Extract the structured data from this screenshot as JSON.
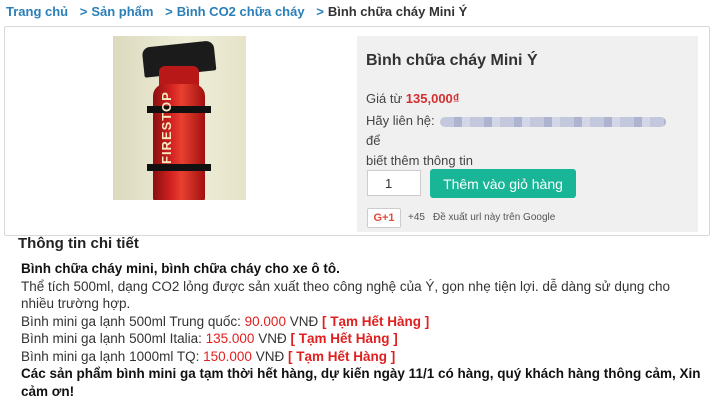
{
  "breadcrumb": {
    "home": "Trang chủ",
    "products": "Sản phẩm",
    "category": "Bình CO2 chữa cháy",
    "current": "Bình chữa cháy Mini Ý",
    "sep": ">"
  },
  "product": {
    "image_text": "FIRESTOP",
    "title": "Bình chữa cháy Mini Ý",
    "price_prefix": "Giá từ",
    "price": "135,000₫",
    "contact_prefix": "Hãy liên hệ:",
    "contact_suffix": "để",
    "contact_line2": "biết thêm thông tin",
    "quantity": "1",
    "add_to_cart": "Thêm vào giỏ hàng",
    "gplus_label": "G+1",
    "gplus_count": "+45",
    "gplus_note": "Đề xuất url này trên Google"
  },
  "details": {
    "heading": "Thông tin chi tiết",
    "line1": "Bình chữa cháy mini, bình chữa cháy cho xe ô tô.",
    "line2": "Thể tích 500ml, dạng CO2 lỏng được sản xuất theo công nghệ của Ý, gọn nhẹ tiện lợi. dễ dàng sử dụng cho nhiều trường hợp.",
    "items": [
      {
        "label": "Bình mini ga lạnh 500ml Trung quốc:",
        "price": "90.000",
        "currency": "VNĐ",
        "status": "[ Tạm Hết Hàng ]"
      },
      {
        "label": "Bình mini ga lạnh 500ml Italia:",
        "price": "135.000",
        "currency": "VNĐ",
        "status": "[ Tạm Hết Hàng ]"
      },
      {
        "label": "Bình mini ga lạnh 1000ml TQ:",
        "price": "150.000",
        "currency": "VNĐ",
        "status": "[ Tạm Hết Hàng ]"
      }
    ],
    "notice": "Các sản phẩm bình mini ga tạm thời hết hàng, dự kiến ngày 11/1 có hàng, quý khách hàng thông cảm, Xin cảm ơn!"
  }
}
